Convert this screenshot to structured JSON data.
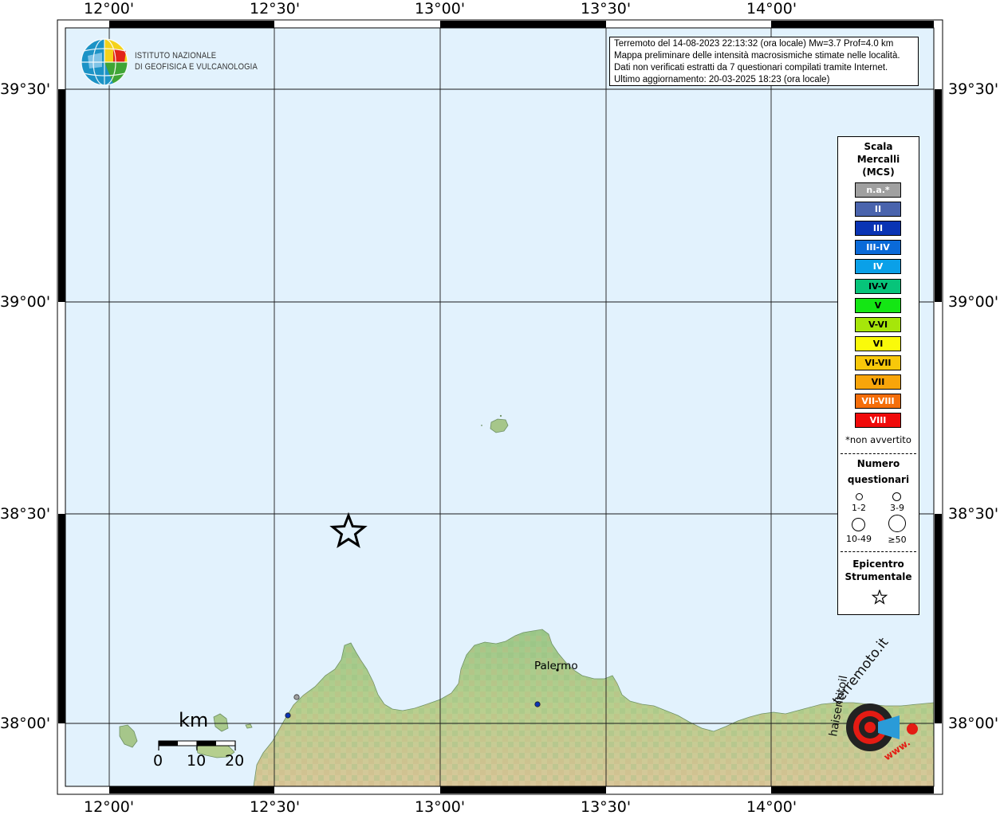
{
  "header": {
    "institute_line1": "ISTITUTO NAZIONALE",
    "institute_line2": "DI GEOFISICA E VULCANOLOGIA"
  },
  "info": {
    "line1": "Terremoto del 14-08-2023 22:13:32 (ora locale) Mw=3.7 Prof=4.0 km",
    "line2": "Mappa preliminare delle intensità macrosismiche stimate nelle località.",
    "line3": "Dati non verificati estratti da 7 questionari compilati tramite Internet.",
    "line4": "Ultimo aggiornamento: 20-03-2025 18:23 (ora locale)"
  },
  "axes": {
    "longitudes": [
      "12°00'",
      "12°30'",
      "13°00'",
      "13°30'",
      "14°00'"
    ],
    "latitudes": [
      "39°30'",
      "39°00'",
      "38°30'",
      "38°00'"
    ]
  },
  "legend": {
    "title_line1": "Scala",
    "title_line2": "Mercalli",
    "title_line3": "(MCS)",
    "classes": [
      {
        "label": "n.a.*",
        "color": "#a0a0a0"
      },
      {
        "label": "II",
        "color": "#4a64ad"
      },
      {
        "label": "III",
        "color": "#0a34b4"
      },
      {
        "label": "III-IV",
        "color": "#0a6ad8"
      },
      {
        "label": "IV",
        "color": "#0aa0e8"
      },
      {
        "label": "IV-V",
        "color": "#07c47a"
      },
      {
        "label": "V",
        "color": "#14e614"
      },
      {
        "label": "V-VI",
        "color": "#a6e60a"
      },
      {
        "label": "VI",
        "color": "#fafa0a"
      },
      {
        "label": "VI-VII",
        "color": "#f8c80a"
      },
      {
        "label": "VII",
        "color": "#f8a50a"
      },
      {
        "label": "VII-VIII",
        "color": "#f56e0a"
      },
      {
        "label": "VIII",
        "color": "#f00a0a"
      }
    ],
    "not_felt_note": "*non avvertito",
    "count_title_line1": "Numero",
    "count_title_line2": "questionari",
    "size_classes": [
      "1-2",
      "3-9",
      "10-49",
      "≥50"
    ],
    "epicenter_line1": "Epicentro",
    "epicenter_line2": "Strumentale"
  },
  "scale_bar": {
    "unit": "km",
    "ticks": [
      "0",
      "10",
      "20"
    ]
  },
  "places": {
    "city": "Palermo"
  },
  "watermark": {
    "text_top": "terremoto.it",
    "text_prefix": "haisentitoil",
    "text_bottom": "www."
  },
  "colors": {
    "sea": "#e2f2fd",
    "grid": "#1a1a1a",
    "epicenter": "#000000",
    "intensity_point": "#0a34b4",
    "na_point": "#a0a0a0"
  }
}
